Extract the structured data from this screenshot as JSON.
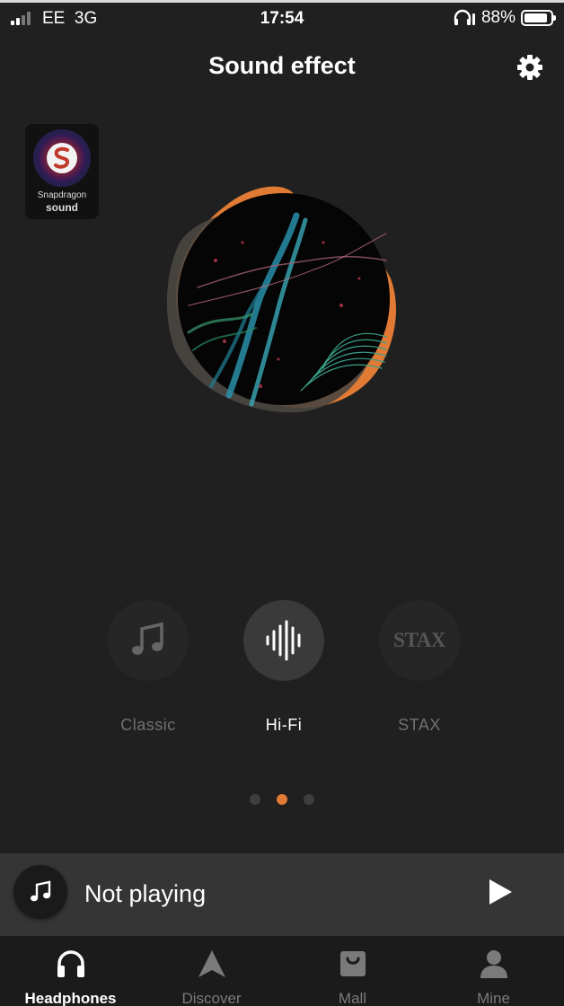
{
  "status": {
    "carrier": "EE",
    "network": "3G",
    "time": "17:54",
    "battery": "88%"
  },
  "header": {
    "title": "Sound effect"
  },
  "badge": {
    "line1": "Snapdragon",
    "line2": "sound"
  },
  "modes": [
    {
      "label": "Classic",
      "icon": "music-note-icon",
      "active": false
    },
    {
      "label": "Hi-Fi",
      "icon": "sound-wave-icon",
      "active": true
    },
    {
      "label": "STAX",
      "icon": "stax-logo",
      "active": false
    }
  ],
  "stax_logo_text": "STAX",
  "pager": {
    "count": 3,
    "active_index": 1
  },
  "player": {
    "status": "Not playing"
  },
  "tabs": [
    {
      "label": "Headphones",
      "icon": "headphones-icon",
      "active": true
    },
    {
      "label": "Discover",
      "icon": "discover-icon",
      "active": false
    },
    {
      "label": "Mall",
      "icon": "shopping-bag-icon",
      "active": false
    },
    {
      "label": "Mine",
      "icon": "person-icon",
      "active": false
    }
  ],
  "colors": {
    "background": "#202020",
    "accent": "#e07a34",
    "player_bar": "#353535",
    "tab_bar": "#1b1b1b"
  }
}
